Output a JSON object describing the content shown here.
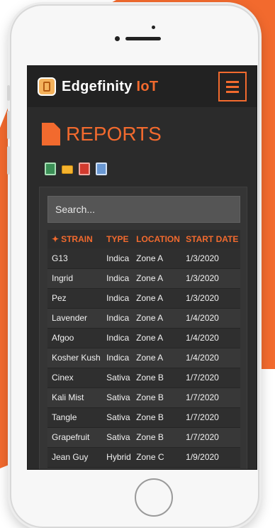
{
  "app": {
    "brand_main": "Edgefinity",
    "brand_accent": "IoT"
  },
  "page": {
    "title": "REPORTS"
  },
  "icons": {
    "logo": "logo-icon",
    "menu": "hamburger-menu-icon",
    "title": "document-icon",
    "exports": [
      "excel-export-icon",
      "email-export-icon",
      "pdf-export-icon",
      "word-export-icon"
    ]
  },
  "search": {
    "placeholder": "Search..."
  },
  "table": {
    "columns": [
      "STRAIN",
      "TYPE",
      "LOCATION",
      "START DATE"
    ],
    "rows": [
      [
        "G13",
        "Indica",
        "Zone A",
        "1/3/2020"
      ],
      [
        "Ingrid",
        "Indica",
        "Zone A",
        "1/3/2020"
      ],
      [
        "Pez",
        "Indica",
        "Zone A",
        "1/3/2020"
      ],
      [
        "Lavender",
        "Indica",
        "Zone A",
        "1/4/2020"
      ],
      [
        "Afgoo",
        "Indica",
        "Zone A",
        "1/4/2020"
      ],
      [
        "Kosher Kush",
        "Indica",
        "Zone A",
        "1/4/2020"
      ],
      [
        "Cinex",
        "Sativa",
        "Zone B",
        "1/7/2020"
      ],
      [
        "Kali Mist",
        "Sativa",
        "Zone B",
        "1/7/2020"
      ],
      [
        "Tangle",
        "Sativa",
        "Zone B",
        "1/7/2020"
      ],
      [
        "Grapefruit",
        "Sativa",
        "Zone B",
        "1/7/2020"
      ],
      [
        "Jean Guy",
        "Hybrid",
        "Zone C",
        "1/9/2020"
      ]
    ]
  },
  "colors": {
    "accent": "#f26a2e",
    "background": "#2b2b2b",
    "navbar": "#222222"
  }
}
